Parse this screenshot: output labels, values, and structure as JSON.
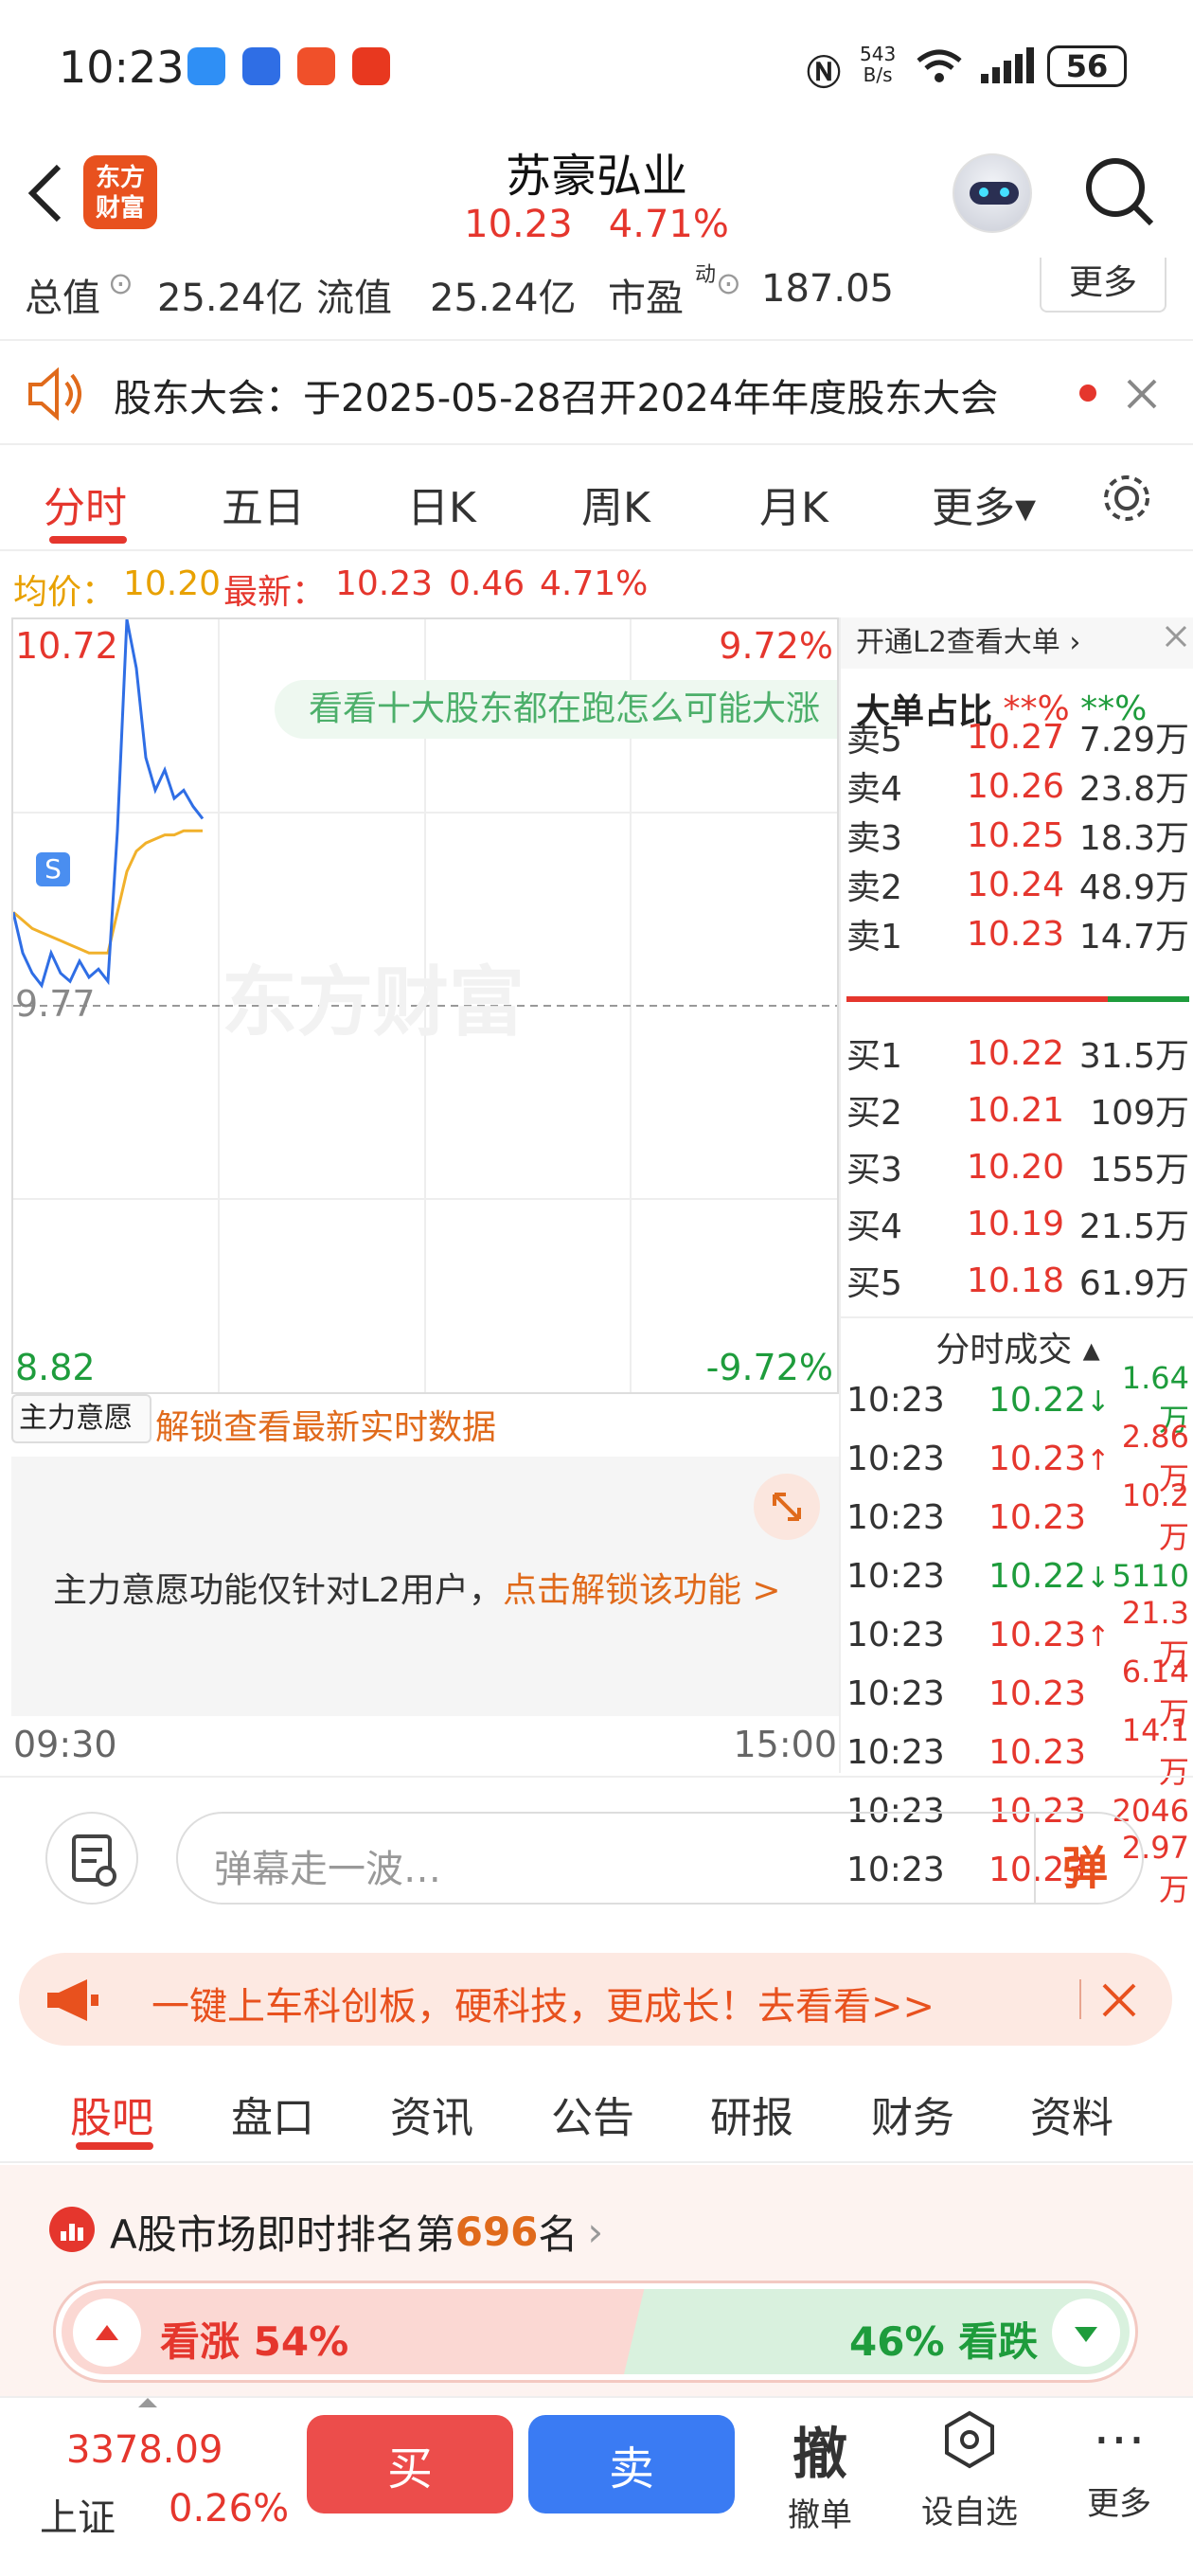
{
  "status": {
    "time": "10:23",
    "net_speed_top": "543",
    "net_speed_bottom": "B/s",
    "battery": "56"
  },
  "header": {
    "logo_line1": "东方",
    "logo_line2": "财富",
    "title": "苏豪弘业",
    "price": "10.23",
    "change_pct": "4.71%"
  },
  "stats": {
    "total_label": "总值",
    "total_value": "25.24亿",
    "float_label": "流值",
    "float_value": "25.24亿",
    "pe_label": "市盈",
    "pe_sup": "动",
    "pe_value": "187.05",
    "more": "更多"
  },
  "notice": {
    "text": "股东大会：于2025-05-28召开2024年年度股东大会"
  },
  "tabs": [
    "分时",
    "五日",
    "日K",
    "周K",
    "月K",
    "更多▾"
  ],
  "avgline": {
    "avg_label": "均价：",
    "avg_value": "10.20",
    "latest_label": "最新：",
    "latest_value": "10.23",
    "change": "0.46",
    "change_pct": "4.71%"
  },
  "chart": {
    "high": "10.72",
    "high_pct": "9.72%",
    "mid": "9.77",
    "low": "8.82",
    "low_pct": "-9.72%",
    "promo": "看看十大股东都在跑怎么可能大涨",
    "watermark": "东方财富",
    "marker": "S",
    "start": "09:30",
    "end": "15:00"
  },
  "chart_data": {
    "type": "line",
    "title": "",
    "series": [
      {
        "name": "",
        "values": [
          10.0,
          9.9,
          9.85,
          9.82,
          9.9,
          9.85,
          9.83,
          9.88,
          9.84,
          9.86,
          9.83,
          10.2,
          10.72,
          10.6,
          10.38,
          10.3,
          10.35,
          10.28,
          10.3,
          10.26,
          10.23
        ]
      },
      {
        "name": "",
        "values": [
          10.0,
          9.98,
          9.96,
          9.95,
          9.94,
          9.93,
          9.92,
          9.91,
          9.9,
          9.9,
          9.9,
          10.0,
          10.1,
          10.15,
          10.17,
          10.18,
          10.19,
          10.19,
          10.2,
          10.2,
          10.2
        ]
      }
    ],
    "ylim": [
      8.82,
      10.72
    ]
  },
  "orderbook": {
    "l2_text": "开通L2查看大单 ›",
    "big_label": "大单占比",
    "big_red": "**%",
    "big_green": "**%",
    "asks": [
      {
        "label": "卖5",
        "price": "10.27",
        "vol": "7.29万"
      },
      {
        "label": "卖4",
        "price": "10.26",
        "vol": "23.8万"
      },
      {
        "label": "卖3",
        "price": "10.25",
        "vol": "18.3万"
      },
      {
        "label": "卖2",
        "price": "10.24",
        "vol": "48.9万"
      },
      {
        "label": "卖1",
        "price": "10.23",
        "vol": "14.7万"
      }
    ],
    "bids": [
      {
        "label": "买1",
        "price": "10.22",
        "vol": "31.5万"
      },
      {
        "label": "买2",
        "price": "10.21",
        "vol": "109万"
      },
      {
        "label": "买3",
        "price": "10.20",
        "vol": "155万"
      },
      {
        "label": "买4",
        "price": "10.19",
        "vol": "21.5万"
      },
      {
        "label": "买5",
        "price": "10.18",
        "vol": "61.9万"
      }
    ],
    "trades_title": "分时成交 ▴",
    "trades": [
      {
        "time": "10:23",
        "price": "10.22",
        "arrow": "↓",
        "vol": "1.64万",
        "color": "green"
      },
      {
        "time": "10:23",
        "price": "10.23",
        "arrow": "↑",
        "vol": "2.86万",
        "color": "red"
      },
      {
        "time": "10:23",
        "price": "10.23",
        "arrow": "",
        "vol": "10.2万",
        "color": "red"
      },
      {
        "time": "10:23",
        "price": "10.22",
        "arrow": "↓",
        "vol": "5110",
        "color": "green"
      },
      {
        "time": "10:23",
        "price": "10.23",
        "arrow": "↑",
        "vol": "21.3万",
        "color": "red"
      },
      {
        "time": "10:23",
        "price": "10.23",
        "arrow": "",
        "vol": "6.14万",
        "color": "red"
      },
      {
        "time": "10:23",
        "price": "10.23",
        "arrow": "",
        "vol": "14.1万",
        "color": "red"
      },
      {
        "time": "10:23",
        "price": "10.23",
        "arrow": "",
        "vol": "2046",
        "color": "red"
      },
      {
        "time": "10:23",
        "price": "10.23",
        "arrow": "",
        "vol": "2.97万",
        "color": "red"
      }
    ]
  },
  "zlyy": {
    "select": "主力意愿 ▾",
    "unlock": "解锁查看最新实时数据",
    "msg": "主力意愿功能仅针对L2用户，",
    "link": "点击解锁该功能 >"
  },
  "danmu": {
    "placeholder": "弹幕走一波…",
    "btn": "弹"
  },
  "banner": {
    "text": "一键上车科创板，硬科技，更成长！去看看>>"
  },
  "bottomtabs": [
    "股吧",
    "盘口",
    "资讯",
    "公告",
    "研报",
    "财务",
    "资料"
  ],
  "rank": {
    "prefix": "A股市场即时排名第",
    "num": "696",
    "suffix": "名",
    "bull": "看涨 54%",
    "bear": "46% 看跌"
  },
  "footer": {
    "index_value": "3378.09",
    "index_name": "上证",
    "index_pct": "0.26%",
    "buy": "买",
    "sell": "卖",
    "cancel_icon": "撤",
    "cancel": "撤单",
    "watch": "设自选",
    "more": "更多"
  }
}
